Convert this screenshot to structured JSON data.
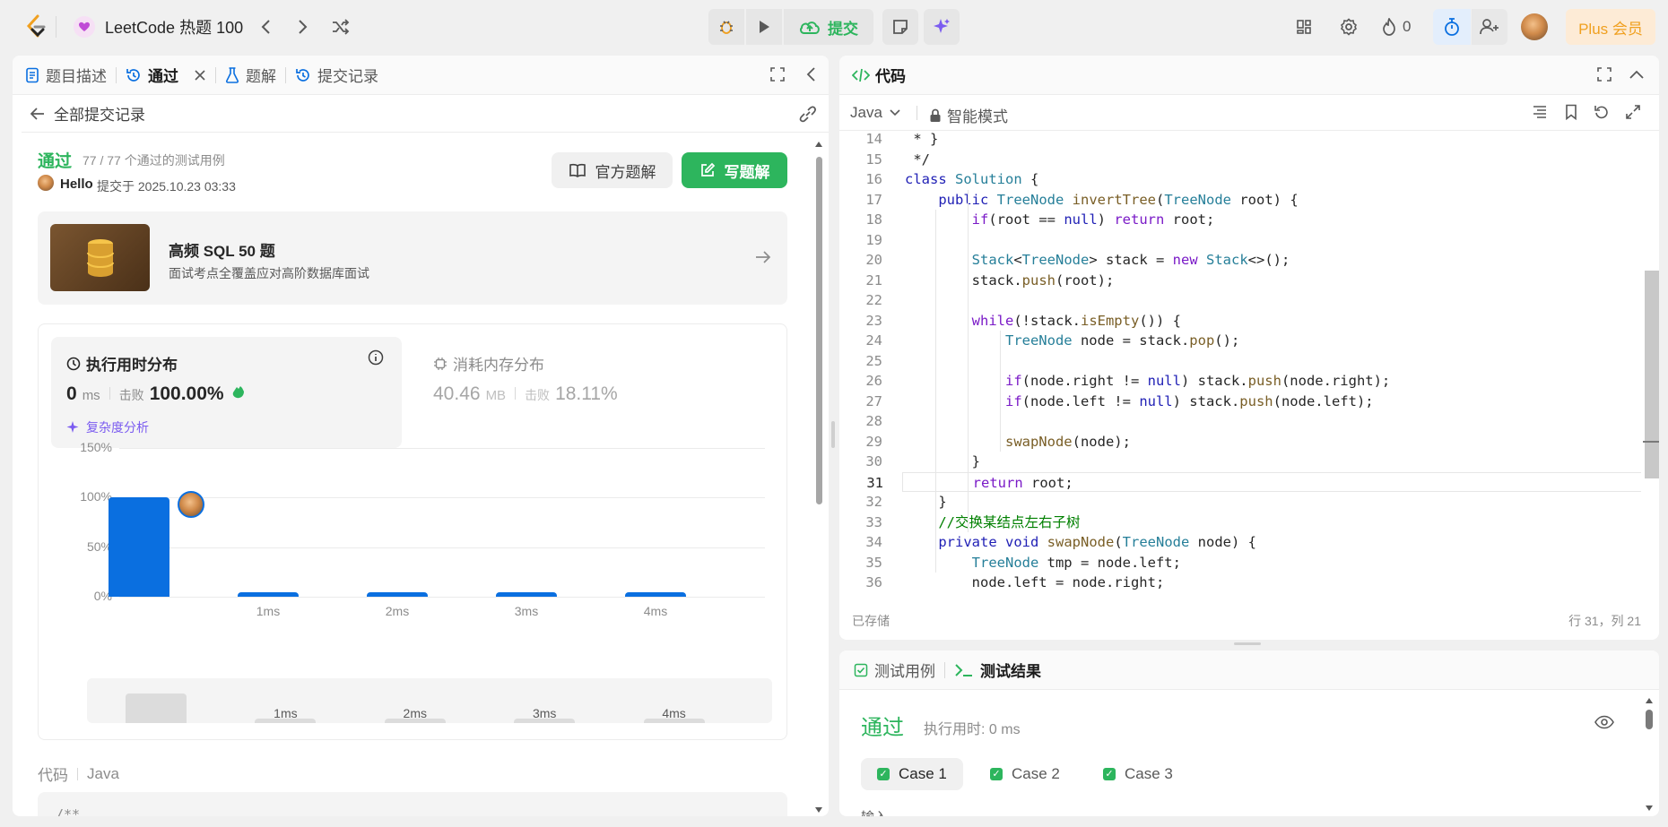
{
  "topbar": {
    "title": "LeetCode 热题 100",
    "submit_label": "提交",
    "streak_count": "0",
    "plus_label": "Plus 会员"
  },
  "left": {
    "tabs": [
      {
        "label": "题目描述"
      },
      {
        "label": "通过"
      },
      {
        "label": "题解"
      },
      {
        "label": "提交记录"
      }
    ],
    "back_label": "全部提交记录",
    "status": "通过",
    "testcases": "77 / 77 个通过的测试用例",
    "username": "Hello",
    "submitted_at": "提交于 2025.10.23 03:33",
    "official_solution_label": "官方题解",
    "write_solution_label": "写题解",
    "promo": {
      "title": "高频 SQL 50 题",
      "subtitle": "面试考点全覆盖应对高阶数据库面试"
    },
    "runtime_title": "执行用时分布",
    "runtime_value": "0",
    "runtime_unit": "ms",
    "beats_label": "击败",
    "runtime_beats": "100.00%",
    "complexity_label": "复杂度分析",
    "memory_title": "消耗内存分布",
    "memory_value": "40.46",
    "memory_unit": "MB",
    "memory_beats": "18.11%",
    "code_label": "代码",
    "code_lang": "Java",
    "code_preview": "/**"
  },
  "chart_data": {
    "type": "bar",
    "categories": [
      "",
      "1ms",
      "2ms",
      "3ms",
      "4ms"
    ],
    "values": [
      100,
      2,
      2,
      2,
      2
    ],
    "ylim": [
      0,
      150
    ],
    "yticks": [
      "0%",
      "50%",
      "100%",
      "150%"
    ],
    "grid": true,
    "mini_labels": [
      "1ms",
      "2ms",
      "3ms",
      "4ms"
    ],
    "mini_values": [
      60,
      10,
      10,
      10,
      10
    ]
  },
  "editor": {
    "title": "代码",
    "language": "Java",
    "mode_label": "智能模式",
    "saved_label": "已存储",
    "cursor_pos": "行 31，列 21",
    "current_line": 31
  },
  "code_lines": [
    {
      "n": "14",
      "html": " * }"
    },
    {
      "n": "15",
      "html": " */"
    },
    {
      "n": "16",
      "html": "<span class='kw2'>class</span> <span class='ty'>Solution</span> {"
    },
    {
      "n": "17",
      "html": "    <span class='kw2'>public</span> <span class='ty'>TreeNode</span> <span class='fn'>invertTree</span>(<span class='ty'>TreeNode</span> root) {"
    },
    {
      "n": "18",
      "html": "        <span class='kw'>if</span>(root == <span class='kw2'>null</span>) <span class='kw'>return</span> root;"
    },
    {
      "n": "19",
      "html": ""
    },
    {
      "n": "20",
      "html": "        <span class='ty'>Stack</span>&lt;<span class='ty'>TreeNode</span>&gt; stack = <span class='kw'>new</span> <span class='ty'>Stack</span>&lt;&gt;();"
    },
    {
      "n": "21",
      "html": "        stack.<span class='fn'>push</span>(root);"
    },
    {
      "n": "22",
      "html": ""
    },
    {
      "n": "23",
      "html": "        <span class='kw'>while</span>(!stack.<span class='fn'>isEmpty</span>()) {"
    },
    {
      "n": "24",
      "html": "            <span class='ty'>TreeNode</span> node = stack.<span class='fn'>pop</span>();"
    },
    {
      "n": "25",
      "html": ""
    },
    {
      "n": "26",
      "html": "            <span class='kw'>if</span>(node.right != <span class='kw2'>null</span>) stack.<span class='fn'>push</span>(node.right);"
    },
    {
      "n": "27",
      "html": "            <span class='kw'>if</span>(node.left != <span class='kw2'>null</span>) stack.<span class='fn'>push</span>(node.left);"
    },
    {
      "n": "28",
      "html": ""
    },
    {
      "n": "29",
      "html": "            <span class='fn'>swapNode</span>(node);"
    },
    {
      "n": "30",
      "html": "        }"
    },
    {
      "n": "31",
      "html": "        <span class='kw'>return</span> root;"
    },
    {
      "n": "32",
      "html": "    }"
    },
    {
      "n": "33",
      "html": "    <span class='cm'>//交换某结点左右子树</span>"
    },
    {
      "n": "34",
      "html": "    <span class='kw2'>private</span> <span class='kw2'>void</span> <span class='fn'>swapNode</span>(<span class='ty'>TreeNode</span> node) {"
    },
    {
      "n": "35",
      "html": "        <span class='ty'>TreeNode</span> tmp = node.left;"
    },
    {
      "n": "36",
      "html": "        node.left = node.right;"
    }
  ],
  "tests": {
    "tab_cases": "测试用例",
    "tab_results": "测试结果",
    "status": "通过",
    "runtime": "执行用时: 0 ms",
    "cases": [
      "Case 1",
      "Case 2",
      "Case 3"
    ],
    "input_label": "输入"
  },
  "colors": {
    "accent_green": "#2db55d",
    "bar_blue": "#0a6fe0",
    "plus_bg": "#fdebd6",
    "plus_text": "#f0a020"
  }
}
